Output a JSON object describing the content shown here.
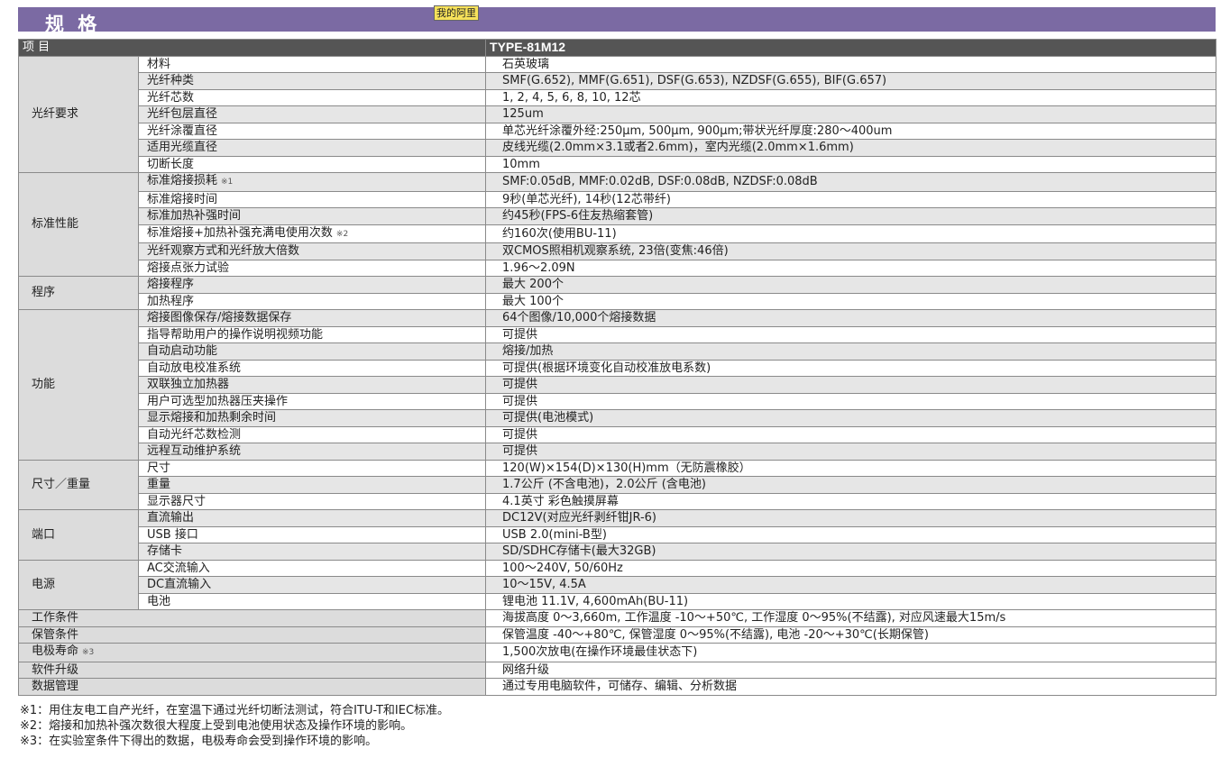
{
  "title": "规 格",
  "tag": "我的阿里",
  "header": {
    "item": "项 目",
    "model": "TYPE-81M12"
  },
  "groups": [
    {
      "category": "光纤要求",
      "rows": [
        {
          "item": "材料",
          "value": "石英玻璃"
        },
        {
          "item": "光纤种类",
          "value": "SMF(G.652), MMF(G.651), DSF(G.653), NZDSF(G.655), BIF(G.657)"
        },
        {
          "item": "光纤芯数",
          "value": "1, 2, 4, 5, 6, 8, 10, 12芯"
        },
        {
          "item": "光纤包层直径",
          "value": "125um"
        },
        {
          "item": "光纤涂覆直径",
          "value": "单芯光纤涂覆外经:250μm, 500μm, 900μm;带状光纤厚度:280～400um"
        },
        {
          "item": "适用光缆直径",
          "value": "皮线光缆(2.0mm×3.1或者2.6mm)，室内光缆(2.0mm×1.6mm)"
        },
        {
          "item": "切断长度",
          "value": "10mm"
        }
      ]
    },
    {
      "category": "标准性能",
      "rows": [
        {
          "item": "标准熔接损耗",
          "note": "※1",
          "value": "SMF:0.05dB, MMF:0.02dB, DSF:0.08dB, NZDSF:0.08dB"
        },
        {
          "item": "标准熔接时间",
          "value": "9秒(单芯光纤), 14秒(12芯带纤)"
        },
        {
          "item": "标准加热补强时间",
          "value": "约45秒(FPS-6住友热缩套管)"
        },
        {
          "item": "标准熔接+加热补强充满电使用次数",
          "note": "※2",
          "value": "约160次(使用BU-11)"
        },
        {
          "item": "光纤观察方式和光纤放大倍数",
          "value": "双CMOS照相机观察系统, 23倍(变焦:46倍)"
        },
        {
          "item": "熔接点张力试验",
          "value": "1.96～2.09N"
        }
      ]
    },
    {
      "category": "程序",
      "rows": [
        {
          "item": "熔接程序",
          "value": "最大 200个"
        },
        {
          "item": "加热程序",
          "value": "最大 100个"
        }
      ]
    },
    {
      "category": "功能",
      "rows": [
        {
          "item": "熔接图像保存/熔接数据保存",
          "value": "64个图像/10,000个熔接数据"
        },
        {
          "item": "指导帮助用户的操作说明视频功能",
          "value": "可提供"
        },
        {
          "item": "自动启动功能",
          "value": "熔接/加热"
        },
        {
          "item": "自动放电校准系统",
          "value": "可提供(根据环境变化自动校准放电系数)"
        },
        {
          "item": "双联独立加热器",
          "value": "可提供"
        },
        {
          "item": "用户可选型加热器压夹操作",
          "value": "可提供"
        },
        {
          "item": "显示熔接和加热剩余时间",
          "value": "可提供(电池模式)"
        },
        {
          "item": "自动光纤芯数检测",
          "value": "可提供"
        },
        {
          "item": "远程互动维护系统",
          "value": "可提供"
        }
      ]
    },
    {
      "category": "尺寸／重量",
      "rows": [
        {
          "item": "尺寸",
          "value": "120(W)×154(D)×130(H)mm（无防震橡胶）"
        },
        {
          "item": "重量",
          "value": "1.7公斤 (不含电池)，2.0公斤 (含电池)"
        },
        {
          "item": "显示器尺寸",
          "value": "4.1英寸 彩色触摸屏幕"
        }
      ]
    },
    {
      "category": "端口",
      "rows": [
        {
          "item": "直流输出",
          "value": "DC12V(对应光纤剥纤钳JR-6)"
        },
        {
          "item": "USB 接口",
          "value": "USB 2.0(mini-B型)"
        },
        {
          "item": "存储卡",
          "value": "SD/SDHC存储卡(最大32GB)"
        }
      ]
    },
    {
      "category": "电源",
      "rows": [
        {
          "item": "AC交流输入",
          "value": "100～240V, 50/60Hz"
        },
        {
          "item": "DC直流输入",
          "value": "10～15V, 4.5A"
        },
        {
          "item": "电池",
          "value": "锂电池 11.1V, 4,600mAh(BU-11)"
        }
      ]
    }
  ],
  "single_rows": [
    {
      "item": "工作条件",
      "value": "海拔高度 0～3,660m, 工作温度 -10～+50℃, 工作湿度 0～95%(不结露), 对应风速最大15m/s"
    },
    {
      "item": "保管条件",
      "value": "保管温度 -40～+80℃, 保管湿度 0～95%(不结露), 电池 -20～+30℃(长期保管)"
    },
    {
      "item": "电极寿命",
      "note": "※3",
      "value": "1,500次放电(在操作环境最佳状态下)"
    },
    {
      "item": "软件升级",
      "value": "网络升级"
    },
    {
      "item": "数据管理",
      "value": "通过专用电脑软件，可储存、编辑、分析数据"
    }
  ],
  "footnotes": [
    "※1：用住友电工自产光纤，在室温下通过光纤切断法测试，符合ITU-T和IEC标准。",
    "※2：熔接和加热补强次数很大程度上受到电池使用状态及操作环境的影响。",
    "※3：在实验室条件下得出的数据，电极寿命会受到操作环境的影响。"
  ]
}
